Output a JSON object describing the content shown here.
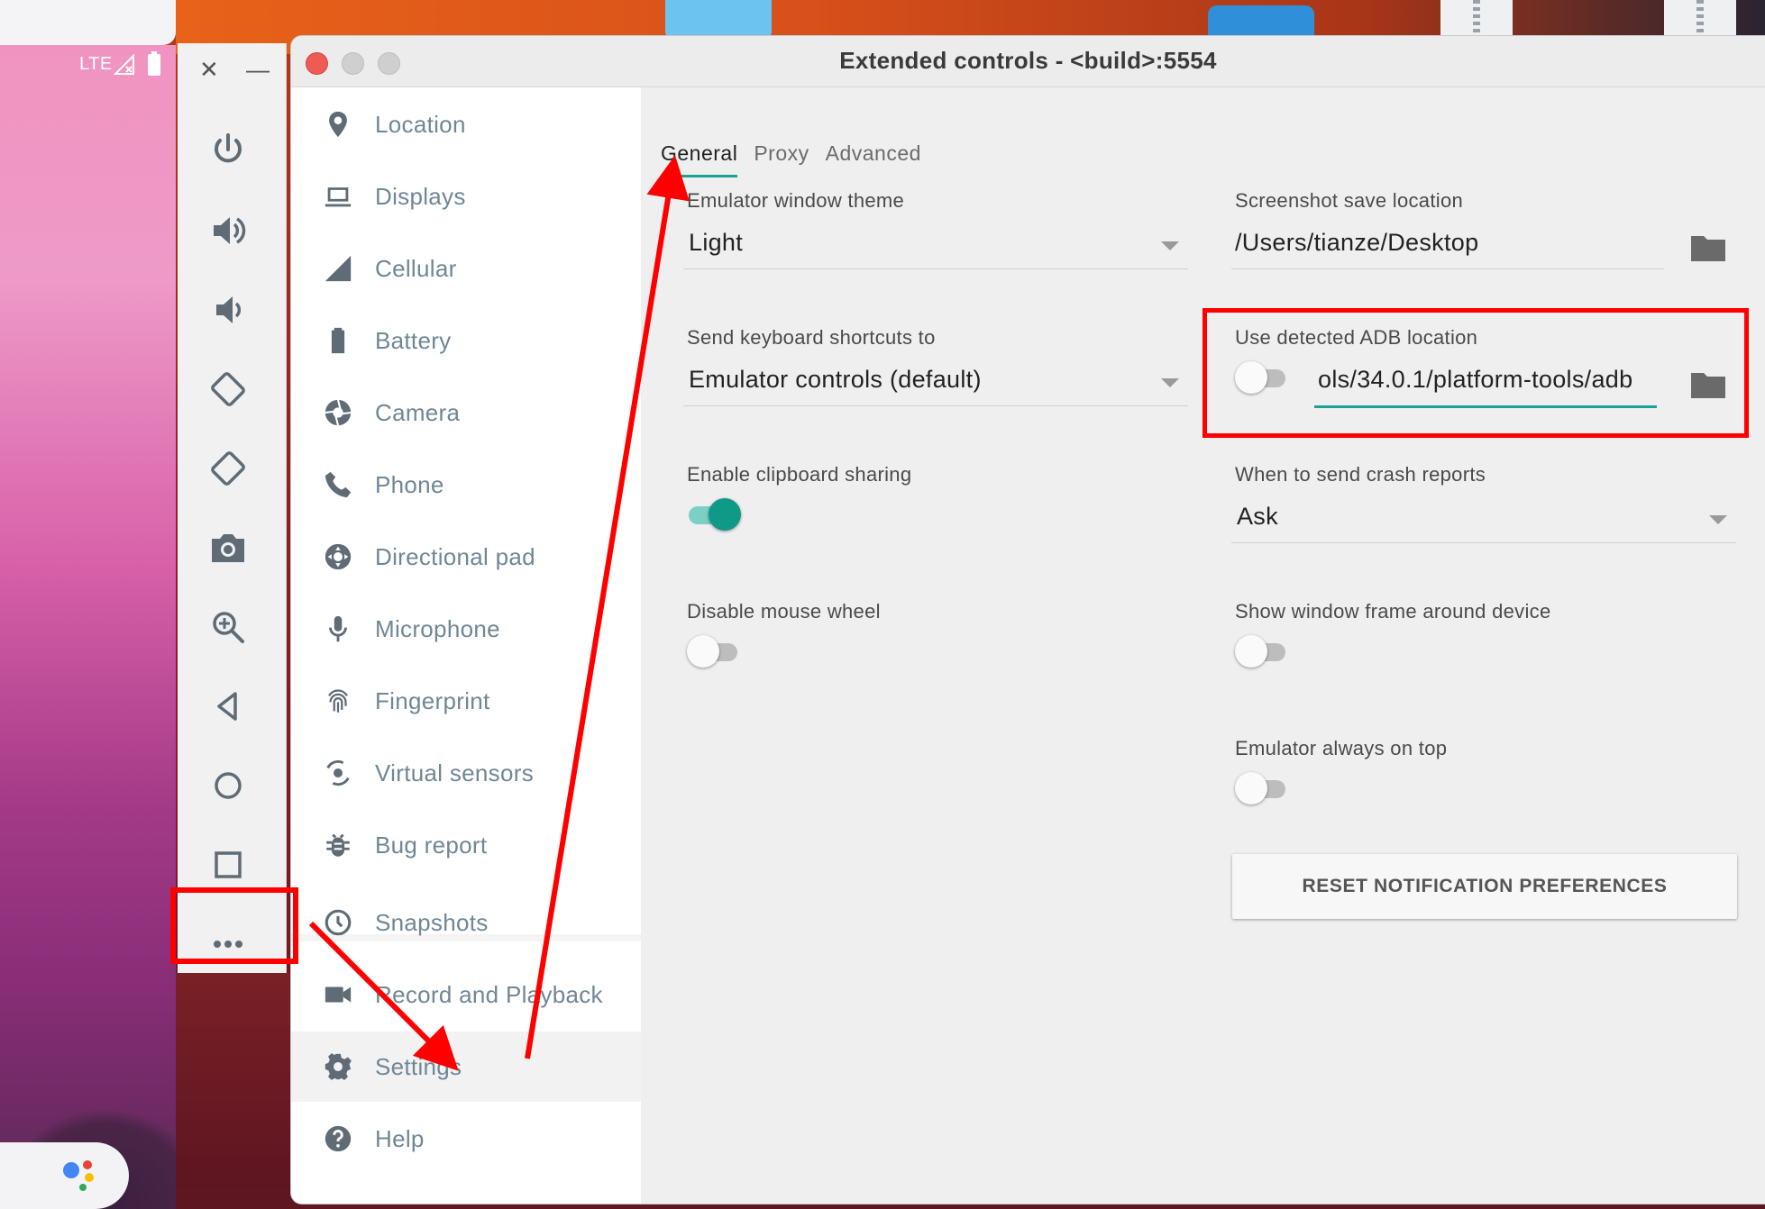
{
  "window": {
    "title": "Extended controls - <build>:5554"
  },
  "phone": {
    "status_network": "LTE"
  },
  "toolbar": {
    "close_glyph": "✕",
    "minimize_glyph": "—",
    "buttons": [
      {
        "icon": "power-icon"
      },
      {
        "icon": "volume-up-icon"
      },
      {
        "icon": "volume-down-icon"
      },
      {
        "icon": "rotate-left-icon"
      },
      {
        "icon": "rotate-right-icon"
      },
      {
        "icon": "camera-icon"
      },
      {
        "icon": "zoom-icon"
      },
      {
        "icon": "back-icon"
      },
      {
        "icon": "home-icon"
      },
      {
        "icon": "overview-icon"
      },
      {
        "icon": "more-icon"
      }
    ]
  },
  "sidebar": {
    "items": [
      {
        "label": "Location",
        "icon": "location-pin-icon"
      },
      {
        "label": "Displays",
        "icon": "display-icon"
      },
      {
        "label": "Cellular",
        "icon": "cellular-icon"
      },
      {
        "label": "Battery",
        "icon": "battery-icon"
      },
      {
        "label": "Camera",
        "icon": "camera-aperture-icon"
      },
      {
        "label": "Phone",
        "icon": "phone-icon"
      },
      {
        "label": "Directional pad",
        "icon": "dpad-icon"
      },
      {
        "label": "Microphone",
        "icon": "microphone-icon"
      },
      {
        "label": "Fingerprint",
        "icon": "fingerprint-icon"
      },
      {
        "label": "Virtual sensors",
        "icon": "virtual-sensors-icon"
      },
      {
        "label": "Bug report",
        "icon": "bug-icon"
      },
      {
        "label": "Snapshots",
        "icon": "snapshots-icon"
      },
      {
        "label": "Record and Playback",
        "icon": "video-camera-icon"
      },
      {
        "label": "Settings",
        "icon": "gear-icon",
        "active": true
      },
      {
        "label": "Help",
        "icon": "help-icon"
      }
    ]
  },
  "tabs": [
    {
      "label": "General",
      "active": true
    },
    {
      "label": "Proxy"
    },
    {
      "label": "Advanced"
    }
  ],
  "settings": {
    "theme": {
      "label": "Emulator window theme",
      "value": "Light"
    },
    "shortcuts": {
      "label": "Send keyboard shortcuts to",
      "value": "Emulator controls (default)"
    },
    "clipboard": {
      "label": "Enable clipboard sharing",
      "on": true
    },
    "mouse_wheel": {
      "label": "Disable mouse wheel",
      "on": false
    },
    "screenshot": {
      "label": "Screenshot save location",
      "value": "/Users/tianze/Desktop"
    },
    "adb": {
      "label": "Use detected ADB location",
      "on": false,
      "value": "ols/34.0.1/platform-tools/adb"
    },
    "crash": {
      "label": "When to send crash reports",
      "value": "Ask"
    },
    "frame": {
      "label": "Show window frame around device",
      "on": false
    },
    "on_top": {
      "label": "Emulator always on top",
      "on": false
    },
    "reset_label": "RESET NOTIFICATION PREFERENCES"
  },
  "colors": {
    "accent": "#1aa391",
    "highlight": "#ff0000",
    "traffic_close": "#ee5b52",
    "traffic_min": "#cfcfcf",
    "traffic_max": "#cfcfcf"
  }
}
